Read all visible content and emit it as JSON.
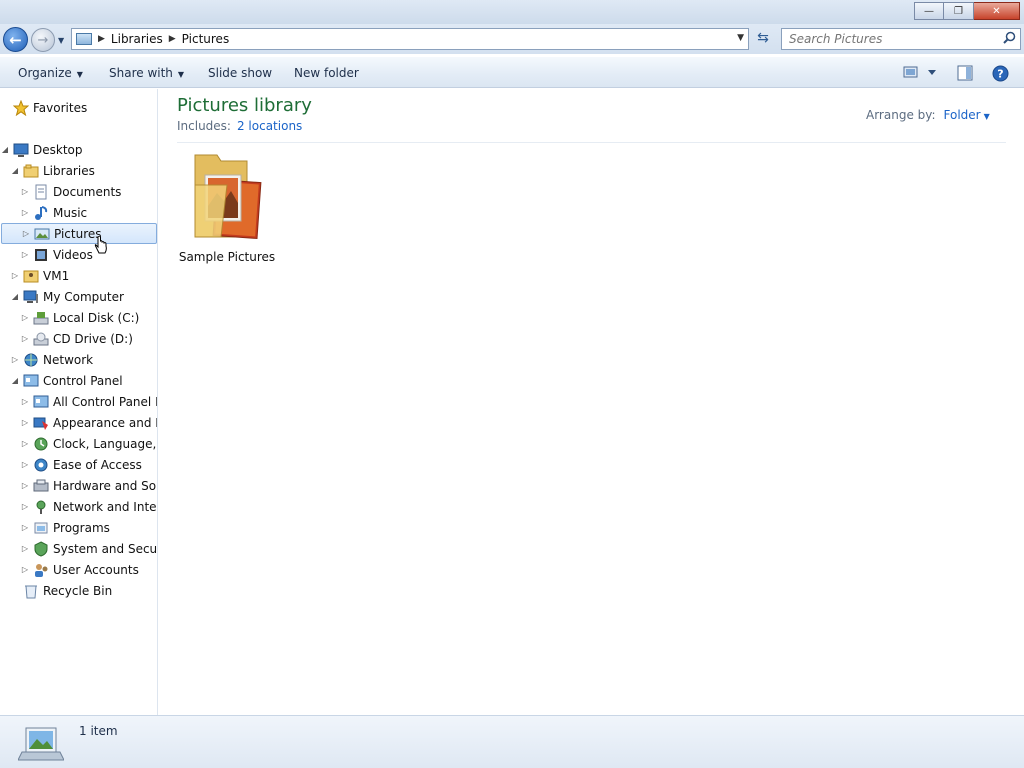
{
  "window": {
    "minimize_label": "—",
    "restore_label": "❐",
    "close_label": "✕"
  },
  "address": {
    "breadcrumbs": [
      "Libraries",
      "Pictures"
    ],
    "search_placeholder": "Search Pictures"
  },
  "toolbar": {
    "organize": "Organize",
    "share_with": "Share with",
    "slide_show": "Slide show",
    "new_folder": "New folder"
  },
  "nav": {
    "items": [
      {
        "label": "Favorites",
        "icon": "star-icon"
      },
      {
        "label": "Desktop",
        "icon": "desktop-icon"
      },
      {
        "label": "Libraries",
        "icon": "libraries-icon"
      },
      {
        "label": "Documents",
        "icon": "documents-icon"
      },
      {
        "label": "Music",
        "icon": "music-icon"
      },
      {
        "label": "Pictures",
        "icon": "pictures-icon",
        "selected": true
      },
      {
        "label": "Videos",
        "icon": "videos-icon"
      },
      {
        "label": "VM1",
        "icon": "user-folder-icon"
      },
      {
        "label": "My Computer",
        "icon": "computer-icon"
      },
      {
        "label": "Local Disk (C:)",
        "icon": "hard-disk-icon"
      },
      {
        "label": "CD Drive (D:)",
        "icon": "cd-drive-icon"
      },
      {
        "label": "Network",
        "icon": "network-icon"
      },
      {
        "label": "Control Panel",
        "icon": "control-panel-icon"
      },
      {
        "label": "All Control Panel Items",
        "icon": "control-panel-icon"
      },
      {
        "label": "Appearance and Personalization",
        "icon": "appearance-icon"
      },
      {
        "label": "Clock, Language, and Region",
        "icon": "clock-icon"
      },
      {
        "label": "Ease of Access",
        "icon": "ease-of-access-icon"
      },
      {
        "label": "Hardware and Sound",
        "icon": "hardware-icon"
      },
      {
        "label": "Network and Internet",
        "icon": "network-internet-icon"
      },
      {
        "label": "Programs",
        "icon": "programs-icon"
      },
      {
        "label": "System and Security",
        "icon": "system-security-icon"
      },
      {
        "label": "User Accounts",
        "icon": "user-accounts-icon"
      },
      {
        "label": "Recycle Bin",
        "icon": "recycle-bin-icon"
      }
    ]
  },
  "content": {
    "title": "Pictures library",
    "includes_label": "Includes:",
    "includes_link": "2 locations",
    "arrange_label": "Arrange by:",
    "arrange_value": "Folder",
    "items": [
      {
        "label": "Sample Pictures",
        "icon": "picture-folder-icon"
      }
    ]
  },
  "status": {
    "item_count": "1 item"
  },
  "colors": {
    "title_green": "#1e6d36",
    "link_blue": "#1b64c8",
    "selection_border": "#84acdd"
  }
}
